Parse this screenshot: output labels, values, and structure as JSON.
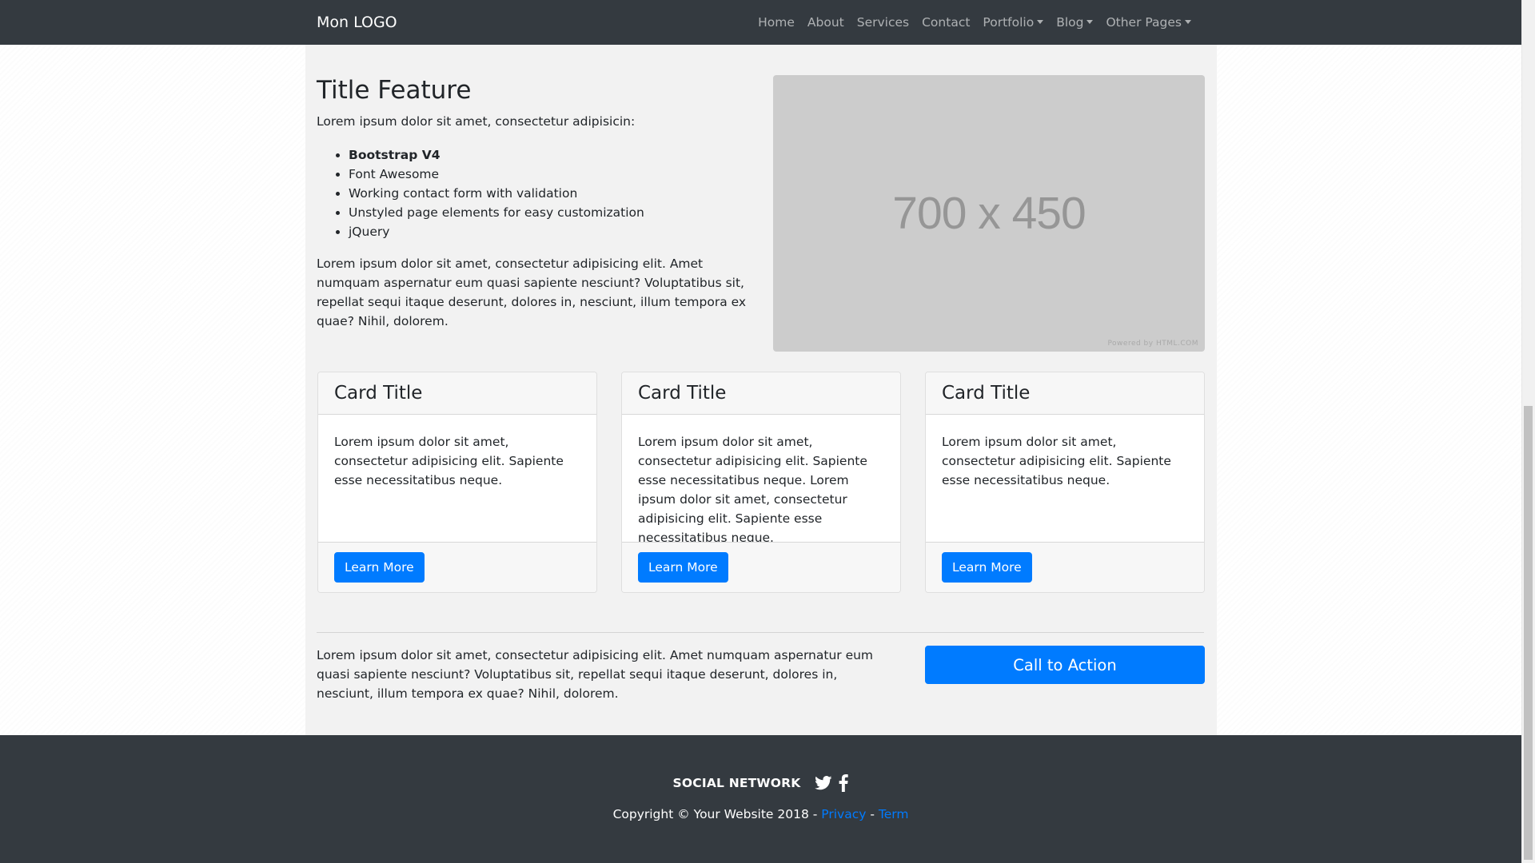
{
  "navbar": {
    "brand": "Mon LOGO",
    "links": [
      {
        "label": "Home"
      },
      {
        "label": "About"
      },
      {
        "label": "Services"
      },
      {
        "label": "Contact"
      },
      {
        "label": "Portfolio",
        "dropdown": true
      },
      {
        "label": "Blog",
        "dropdown": true
      },
      {
        "label": "Other Pages",
        "dropdown": true
      }
    ]
  },
  "feature": {
    "title": "Title Feature",
    "intro": "Lorem ipsum dolor sit amet, consectetur adipisicin:",
    "list": [
      "Bootstrap V4",
      "Font Awesome",
      "Working contact form with validation",
      "Unstyled page elements for easy customization",
      "jQuery"
    ],
    "paragraph": "Lorem ipsum dolor sit amet, consectetur adipisicing elit. Amet numquam aspernatur eum quasi sapiente nesciunt? Voluptatibus sit, repellat sequi itaque deserunt, dolores in, nesciunt, illum tempora ex quae? Nihil, dolorem.",
    "image_text": "700 x 450",
    "image_credit": "Powered by HTML.COM"
  },
  "cards": [
    {
      "title": "Card Title",
      "body": "Lorem ipsum dolor sit amet, consectetur adipisicing elit. Sapiente esse necessitatibus neque.",
      "button": "Learn More"
    },
    {
      "title": "Card Title",
      "body": "Lorem ipsum dolor sit amet, consectetur adipisicing elit. Sapiente esse necessitatibus neque. Lorem ipsum dolor sit amet, consectetur adipisicing elit. Sapiente esse necessitatibus neque.",
      "button": "Learn More"
    },
    {
      "title": "Card Title",
      "body": "Lorem ipsum dolor sit amet, consectetur adipisicing elit. Sapiente esse necessitatibus neque.",
      "button": "Learn More"
    }
  ],
  "cta": {
    "text": "Lorem ipsum dolor sit amet, consectetur adipisicing elit. Amet numquam aspernatur eum quasi sapiente nesciunt? Voluptatibus sit, repellat sequi itaque deserunt, dolores in, nesciunt, illum tempora ex quae? Nihil, dolorem.",
    "button": "Call to Action"
  },
  "footer": {
    "social_label": "SOCIAL NETWORK",
    "social_icons": [
      "twitter-icon",
      "facebook-icon"
    ],
    "copyright": "Copyright © Your Website 2018 - ",
    "privacy": "Privacy",
    "separator": " - ",
    "term": "Term"
  },
  "colors": {
    "navbar": "#343a40",
    "primary": "#007bff",
    "container": "#f2f2f2",
    "placeholder": "#cccccc"
  }
}
